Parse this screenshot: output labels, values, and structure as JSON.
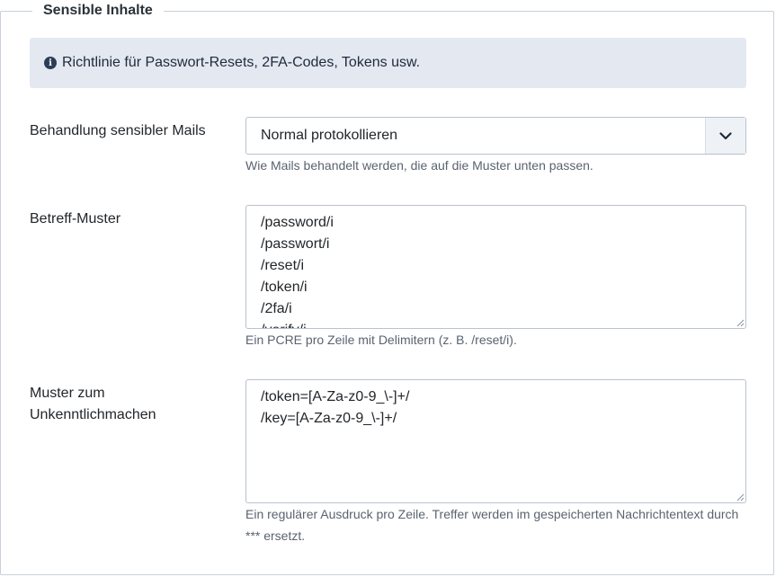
{
  "fieldset": {
    "legend": "Sensible Inhalte"
  },
  "alert": {
    "text": "Richtlinie für Passwort-Resets, 2FA-Codes, Tokens usw."
  },
  "handling": {
    "label": "Behandlung sensibler Mails",
    "selected": "Normal protokollieren",
    "help": "Wie Mails behandelt werden, die auf die Muster unten passen."
  },
  "subject": {
    "label": "Betreff-Muster",
    "lines": [
      "/password/i",
      "/passwort/i",
      "/reset/i",
      "/token/i",
      "/2fa/i",
      "/verify/i"
    ],
    "help": "Ein PCRE pro Zeile mit Delimitern (z. B. /reset/i)."
  },
  "mask": {
    "label_line1": "Muster zum",
    "label_line2": "Unkenntlichmachen",
    "lines": [
      "/token=[A-Za-z0-9_\\-]+/",
      "/key=[A-Za-z0-9_\\-]+/"
    ],
    "help_line1": "Ein regulärer Ausdruck pro Zeile. Treffer werden im gespeicherten Nachrichtentext durch",
    "help_line2": "*** ersetzt."
  }
}
